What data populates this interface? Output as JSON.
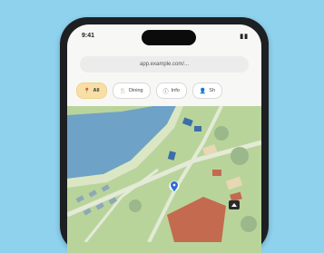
{
  "status": {
    "time": "9:41",
    "icons": "▮▮"
  },
  "browser": {
    "url": "app.example.com/..."
  },
  "filters": [
    {
      "label": "All",
      "icon": "pin-icon",
      "active": true
    },
    {
      "label": "Dining",
      "icon": "fork-knife-icon",
      "active": false
    },
    {
      "label": "Info",
      "icon": "info-icon",
      "active": false
    },
    {
      "label": "Sh",
      "icon": "person-icon",
      "active": false
    }
  ],
  "map": {
    "marker_icon": "location-pin-icon",
    "colors": {
      "water": "#6fa2c7",
      "land": "#b9d49b",
      "road": "#d6e4c8",
      "building_red": "#c46a4f",
      "building_blue": "#3d6ea8",
      "accent_chip": "#f7dfa6"
    }
  }
}
